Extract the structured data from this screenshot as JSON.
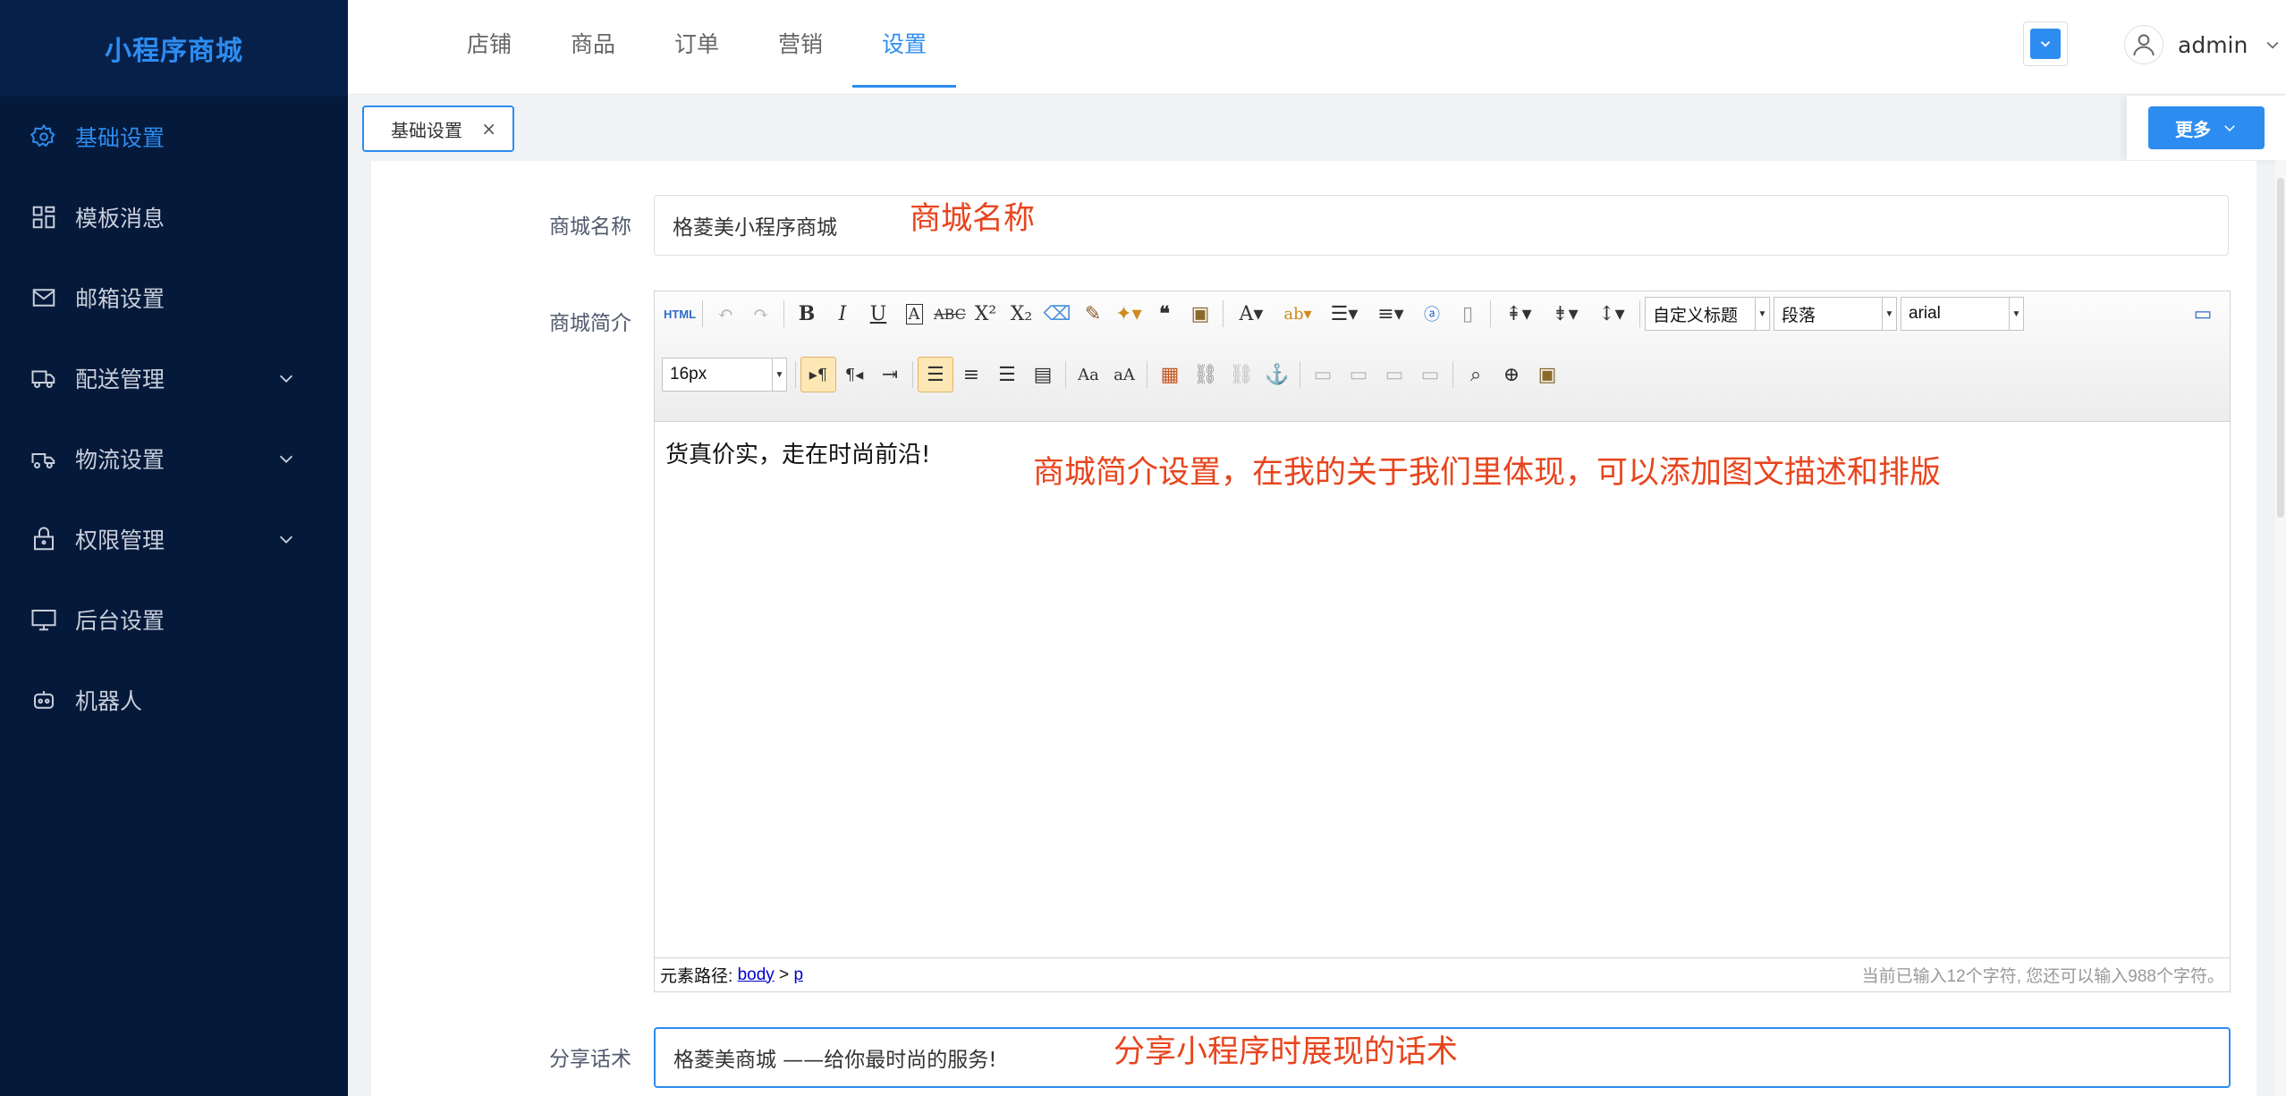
{
  "app": {
    "logo": "小程序商城"
  },
  "sidebar": {
    "items": [
      {
        "label": "基础设置",
        "icon": "gear-icon",
        "active": true
      },
      {
        "label": "模板消息",
        "icon": "grid-icon"
      },
      {
        "label": "邮箱设置",
        "icon": "mail-icon"
      },
      {
        "label": "配送管理",
        "icon": "truck-icon",
        "expandable": true
      },
      {
        "label": "物流设置",
        "icon": "logistics-icon",
        "expandable": true
      },
      {
        "label": "权限管理",
        "icon": "lock-icon",
        "expandable": true
      },
      {
        "label": "后台设置",
        "icon": "monitor-icon"
      },
      {
        "label": "机器人",
        "icon": "robot-icon"
      }
    ]
  },
  "header": {
    "nav": [
      {
        "label": "店铺"
      },
      {
        "label": "商品"
      },
      {
        "label": "订单"
      },
      {
        "label": "营销"
      },
      {
        "label": "设置",
        "active": true
      }
    ],
    "user": {
      "name": "admin"
    }
  },
  "tabs": {
    "items": [
      {
        "label": "基础设置",
        "close": "×"
      }
    ],
    "more_label": "更多"
  },
  "form": {
    "name": {
      "label": "商城名称",
      "value": "格菱美小程序商城",
      "note": "商城名称"
    },
    "intro": {
      "label": "商城简介",
      "content": "货真价实，走在时尚前沿!",
      "note": "商城简介设置，在我的关于我们里体现，可以添加图文描述和排版"
    },
    "share": {
      "label": "分享话术",
      "value": "格菱美商城 ——给你最时尚的服务!",
      "note": "分享小程序时展现的话术"
    }
  },
  "editor": {
    "toolbar": {
      "html_label": "HTML",
      "heading_select": "自定义标题",
      "paragraph_select": "段落",
      "font_select": "arial",
      "size_select": "16px"
    },
    "status": {
      "path_label": "元素路径:",
      "path_body": "body",
      "path_sep": ">",
      "path_p": "p",
      "count_text": "当前已输入12个字符, 您还可以输入988个字符。"
    }
  },
  "colors": {
    "accent": "#2d8cf0",
    "sidebar": "#05193a",
    "annotation": "#e8451e"
  }
}
